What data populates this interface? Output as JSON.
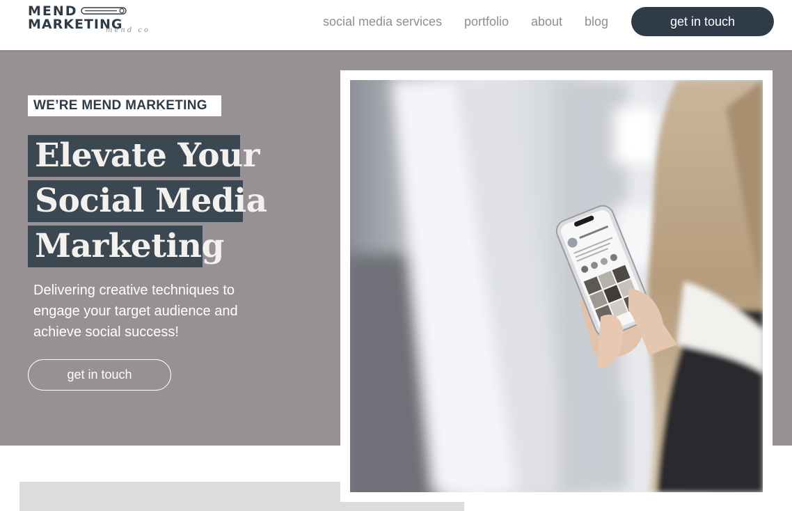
{
  "header": {
    "logo": {
      "line1": "MEND",
      "line2": "MARKETING",
      "script": "mend co"
    },
    "nav": [
      {
        "label": "social media services"
      },
      {
        "label": "portfolio"
      },
      {
        "label": "about"
      },
      {
        "label": "blog"
      }
    ],
    "cta_label": "get in touch"
  },
  "hero": {
    "eyebrow": "WE’RE MEND MARKETING",
    "headline": [
      "Elevate Your",
      "Social Media",
      "Marketing"
    ],
    "subtext": "Delivering creative techniques to engage your target audience and achieve social success!",
    "cta_label": "get in touch",
    "image_icon": "photo-woman-holding-phone"
  },
  "colors": {
    "hero_background": "#979195",
    "headline_block": "#3b4751",
    "primary_button": "#2f3c47",
    "nav_text": "#8f8f8f",
    "strip": "#dedbdc"
  }
}
